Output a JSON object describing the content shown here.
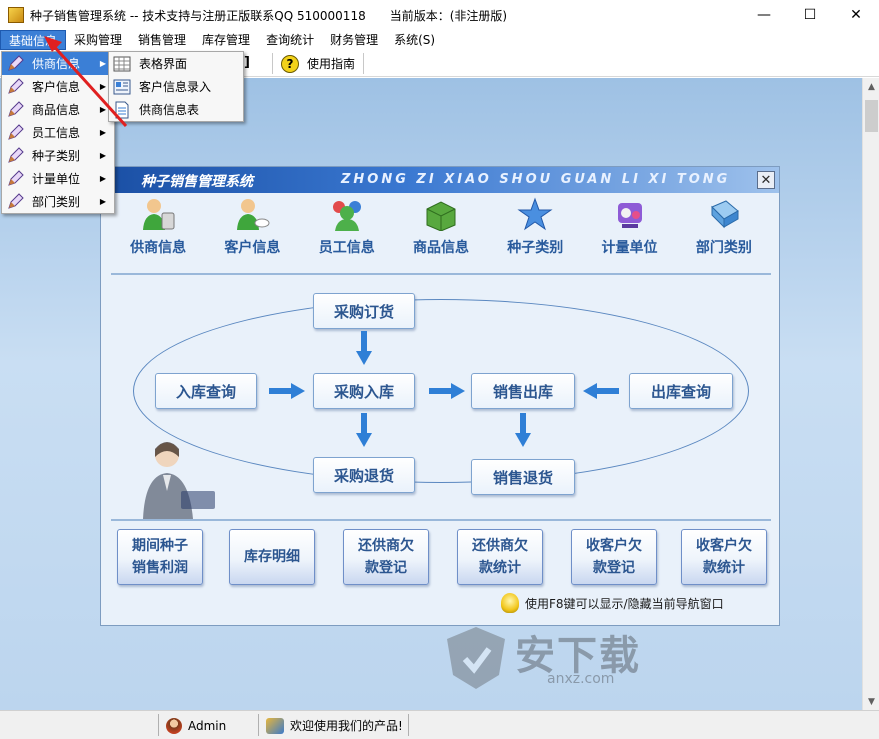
{
  "window": {
    "title": "种子销售管理系统 -- 技术支持与注册正版联系QQ 510000118",
    "version": "当前版本：(非注册版)",
    "controls": {
      "minimize": "—",
      "maximize": "☐",
      "close": "✕"
    }
  },
  "menubar": {
    "items": [
      "基础信息",
      "采购管理",
      "销售管理",
      "库存管理",
      "查询统计",
      "财务管理",
      "系统(S)"
    ]
  },
  "toolbar": {
    "bracket": "]",
    "help_label": "使用指南"
  },
  "menu_basic": {
    "items": [
      {
        "label": "供商信息",
        "icon": "pencil-icon"
      },
      {
        "label": "客户信息",
        "icon": "pencil-icon"
      },
      {
        "label": "商品信息",
        "icon": "pencil-icon"
      },
      {
        "label": "员工信息",
        "icon": "pencil-icon"
      },
      {
        "label": "种子类别",
        "icon": "pencil-icon"
      },
      {
        "label": "计量单位",
        "icon": "pencil-icon"
      },
      {
        "label": "部门类别",
        "icon": "pencil-icon"
      }
    ]
  },
  "menu_supplier": {
    "items": [
      {
        "label": "表格界面",
        "icon": "grid-icon"
      },
      {
        "label": "客户信息录入",
        "icon": "form-icon"
      },
      {
        "label": "供商信息表",
        "icon": "document-icon"
      }
    ]
  },
  "nav": {
    "title": "种子销售管理系统",
    "subtitle": "ZHONG ZI XIAO SHOU GUAN LI XI TONG",
    "close": "✕",
    "icons": [
      {
        "label": "供商信息",
        "icon": "supplier-icon"
      },
      {
        "label": "客户信息",
        "icon": "customer-icon"
      },
      {
        "label": "员工信息",
        "icon": "employee-icon"
      },
      {
        "label": "商品信息",
        "icon": "product-icon"
      },
      {
        "label": "种子类别",
        "icon": "star-icon"
      },
      {
        "label": "计量单位",
        "icon": "unit-icon"
      },
      {
        "label": "部门类别",
        "icon": "department-icon"
      }
    ],
    "flow": {
      "purchase_order": "采购订货",
      "stock_in_query": "入库查询",
      "purchase_in": "采购入库",
      "sales_out": "销售出库",
      "stock_out_query": "出库查询",
      "purchase_return": "采购退货",
      "sales_return": "销售退货"
    },
    "bottom_buttons": [
      {
        "line1": "期间种子",
        "line2": "销售利润"
      },
      {
        "line1": "库存明细",
        "line2": ""
      },
      {
        "line1": "还供商欠",
        "line2": "款登记"
      },
      {
        "line1": "还供商欠",
        "line2": "款统计"
      },
      {
        "line1": "收客户欠",
        "line2": "款登记"
      },
      {
        "line1": "收客户欠",
        "line2": "款统计"
      }
    ],
    "hint": "使用F8键可以显示/隐藏当前导航窗口"
  },
  "watermark": {
    "text": "安下载",
    "sub": "anxz.com"
  },
  "status": {
    "user": "Admin",
    "message": "欢迎使用我们的产品!"
  },
  "colors": {
    "accent": "#3b7fd6",
    "workspace": "#bcd5ee",
    "nav_header": "#1a4fa4",
    "button_text": "#2c5690"
  }
}
